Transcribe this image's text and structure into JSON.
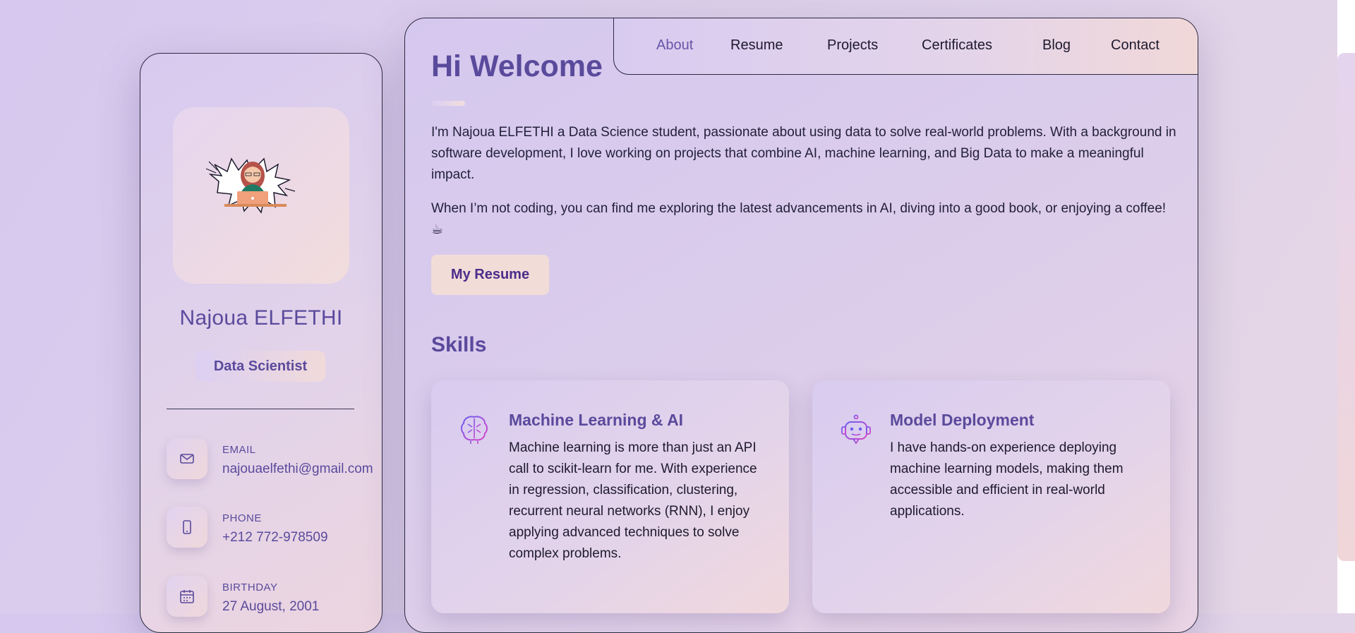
{
  "nav": {
    "items": [
      "About",
      "Resume",
      "Projects",
      "Certificates",
      "Blog",
      "Contact"
    ],
    "active": "About"
  },
  "sidebar": {
    "name": "Najoua ELFETHI",
    "role": "Data Scientist",
    "contacts": [
      {
        "label": "EMAIL",
        "value": "najouaelfethi@gmail.com",
        "icon": "mail-icon"
      },
      {
        "label": "PHONE",
        "value": "+212 772-978509",
        "icon": "phone-icon"
      },
      {
        "label": "BIRTHDAY",
        "value": "27 August, 2001",
        "icon": "calendar-icon"
      }
    ]
  },
  "about": {
    "title": "Hi Welcome",
    "paragraph1": "I'm Najoua ELFETHI a Data Science student, passionate about using data to solve real-world problems. With a background in software development, I love working on projects that combine AI, machine learning, and Big Data to make a meaningful impact.",
    "paragraph2": "When I’m not coding, you can find me exploring the latest advancements in AI, diving into a good book, or enjoying a coffee! ☕",
    "resume_button": "My Resume"
  },
  "skills": {
    "heading": "Skills",
    "cards": [
      {
        "title": "Machine Learning & AI",
        "text": "Machine learning is more than just an API call to scikit-learn for me. With experience in regression, classification, clustering, recurrent neural networks (RNN), I enjoy applying advanced techniques to solve complex problems.",
        "icon": "brain-icon"
      },
      {
        "title": "Model Deployment",
        "text": "I have hands-on experience deploying machine learning models, making them accessible and efficient in real-world applications.",
        "icon": "robot-icon"
      }
    ]
  },
  "colors": {
    "accent": "#5a4a9c",
    "button_bg": "#f2dcd8",
    "button_text": "#4a2d8a"
  }
}
